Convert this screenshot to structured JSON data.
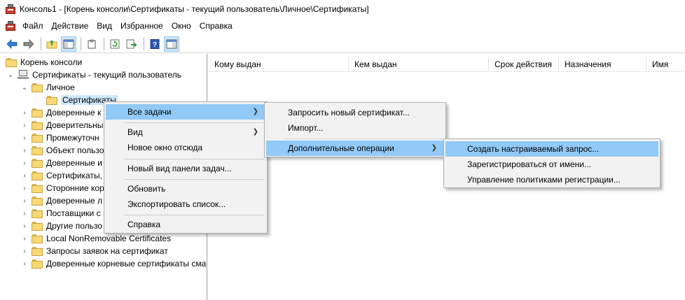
{
  "window": {
    "title": "Консоль1 - [Корень консоли\\Сертификаты - текущий пользователь\\Личное\\Сертификаты]"
  },
  "menubar": [
    "Файл",
    "Действие",
    "Вид",
    "Избранное",
    "Окно",
    "Справка"
  ],
  "toolbar": {
    "icons": [
      "back-arrow-icon",
      "forward-arrow-icon",
      "up-folder-icon",
      "show-hide-tree-icon",
      "clipboard-icon",
      "refresh-icon",
      "export-list-icon",
      "help-icon",
      "action-pane-icon"
    ]
  },
  "tree": {
    "root": "Корень консоли",
    "store": "Сертификаты - текущий пользователь",
    "personal": "Личное",
    "certificates": "Сертификаты",
    "items": [
      "Доверенные к",
      "Доверительны",
      "Промежуточн",
      "Объект пользо",
      "Доверенные и",
      "Сертификаты,",
      "Сторонние кор",
      "Доверенные л",
      "Поставщики с",
      "Другие пользо",
      "Local NonRemovable Certificates",
      "Запросы заявок на сертификат",
      "Доверенные корневые сертификаты сма"
    ]
  },
  "columns": [
    "Кому выдан",
    "Кем выдан",
    "Срок действия",
    "Назначения",
    "Имя"
  ],
  "context_menu": {
    "all_tasks": "Все задачи",
    "view": "Вид",
    "new_window": "Новое окно отсюда",
    "new_taskpad": "Новый вид панели задач...",
    "refresh": "Обновить",
    "export_list": "Экспортировать список...",
    "help": "Справка"
  },
  "submenu1": {
    "request_new": "Запросить новый сертификат...",
    "import": "Импорт...",
    "advanced": "Дополнительные операции"
  },
  "submenu2": {
    "custom_request": "Создать настраиваемый запрос...",
    "enroll_on_behalf": "Зарегистрироваться от имени...",
    "manage_policies": "Управление политиками регистрации..."
  }
}
